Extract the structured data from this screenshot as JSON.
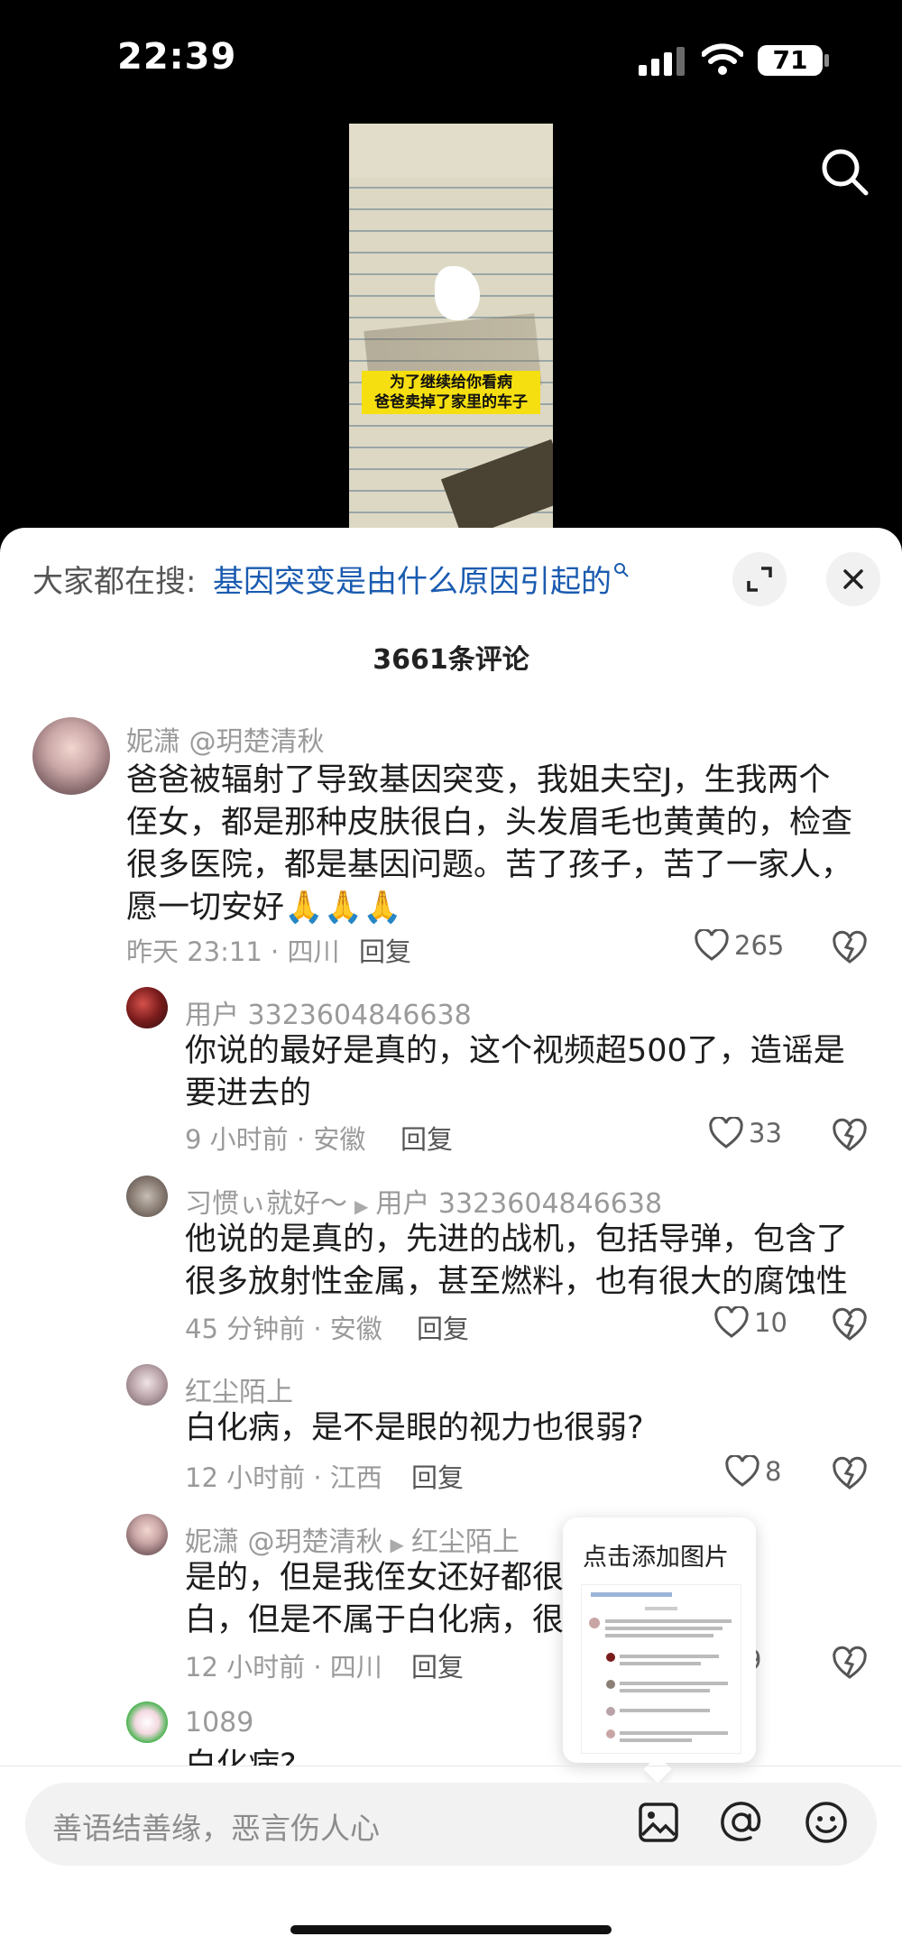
{
  "status_bar": {
    "time": "22:39",
    "battery": "71"
  },
  "video": {
    "caption_line1": "为了继续给你看病",
    "caption_line2": "爸爸卖掉了家里的车子"
  },
  "search_suggest": {
    "label": "大家都在搜:",
    "query": "基因突变是由什么原因引起的"
  },
  "comments_count": "3661条评论",
  "comments": [
    {
      "user": "妮潇 @玥楚清秋",
      "text_lines": [
        "爸爸被辐射了导致基因突变，我姐夫空J，生我两个",
        "侄女，都是那种皮肤很白，头发眉毛也黄黄的，检查",
        "很多医院，都是基因问题。苦了孩子，苦了一家人，",
        "愿一切安好🙏🙏🙏"
      ],
      "meta": "昨天 23:11 · 四川",
      "reply": "回复",
      "likes": "265"
    },
    {
      "user": "用户 3323604846638",
      "text_lines": [
        "你说的最好是真的，这个视频超500了，造谣是",
        "要进去的"
      ],
      "meta": "9 小时前 · 安徽",
      "reply": "回复",
      "likes": "33"
    },
    {
      "user": "习惯ぃ就好～",
      "reply_to": "用户 3323604846638",
      "text_lines": [
        "他说的是真的，先进的战机，包括导弹，包含了",
        "很多放射性金属，甚至燃料，也有很大的腐蚀性"
      ],
      "meta": "45 分钟前 · 安徽",
      "reply": "回复",
      "likes": "10"
    },
    {
      "user": "红尘陌上",
      "text_lines": [
        "白化病，是不是眼的视力也很弱?"
      ],
      "meta": "12 小时前 · 江西",
      "reply": "回复",
      "likes": "8"
    },
    {
      "user": "妮潇 @玥楚清秋",
      "reply_to": "红尘陌上",
      "text_lines": [
        "是的，但是我侄女还好都很",
        "白，但是不属于白化病，很"
      ],
      "meta": "12 小时前 · 四川",
      "reply": "回复",
      "likes": "9"
    },
    {
      "user": "1089",
      "text_lines": [
        "白化病?"
      ]
    }
  ],
  "popup": {
    "title": "点击添加图片"
  },
  "input": {
    "placeholder": "善语结善缘，恶言伤人心"
  },
  "icons": [
    "search-icon",
    "expand-icon",
    "close-icon",
    "heart-icon",
    "dislike-icon",
    "image-icon",
    "at-icon",
    "emoji-icon"
  ]
}
